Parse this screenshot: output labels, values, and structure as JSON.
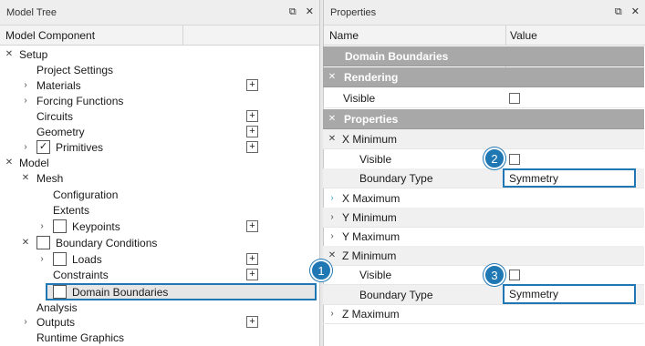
{
  "tree_panel": {
    "title": "Model Tree",
    "pin_icon": "pin-icon",
    "close_icon": "close-icon",
    "column": "Model Component",
    "rows": [
      {
        "label": "Setup",
        "expanded": true
      },
      {
        "label": "Project Settings"
      },
      {
        "label": "Materials"
      },
      {
        "label": "Forcing Functions"
      },
      {
        "label": "Circuits"
      },
      {
        "label": "Geometry"
      },
      {
        "label": "Primitives"
      },
      {
        "label": "Model",
        "expanded": true
      },
      {
        "label": "Mesh",
        "expanded": true
      },
      {
        "label": "Configuration"
      },
      {
        "label": "Extents"
      },
      {
        "label": "Keypoints"
      },
      {
        "label": "Boundary Conditions",
        "expanded": true
      },
      {
        "label": "Loads"
      },
      {
        "label": "Constraints"
      },
      {
        "label": "Domain Boundaries",
        "selected": true
      },
      {
        "label": "Analysis"
      },
      {
        "label": "Outputs"
      },
      {
        "label": "Runtime Graphics"
      }
    ]
  },
  "props_panel": {
    "title": "Properties",
    "col_name": "Name",
    "col_value": "Value",
    "header": "Domain Boundaries",
    "rendering": "Rendering",
    "visible": "Visible",
    "properties": "Properties",
    "x_minimum": "X Minimum",
    "x_min_visible": "Visible",
    "x_min_boundary_type": "Boundary Type",
    "x_min_boundary_value": "Symmetry",
    "x_maximum": "X Maximum",
    "y_minimum": "Y Minimum",
    "y_maximum": "Y Maximum",
    "z_minimum": "Z Minimum",
    "z_min_visible": "Visible",
    "z_min_boundary_type": "Boundary Type",
    "z_min_boundary_value": "Symmetry",
    "z_maximum": "Z Maximum"
  },
  "callouts": [
    "1",
    "2",
    "3"
  ],
  "colors": {
    "accent": "#1f78b4",
    "category_bg": "#a8a8a8"
  }
}
